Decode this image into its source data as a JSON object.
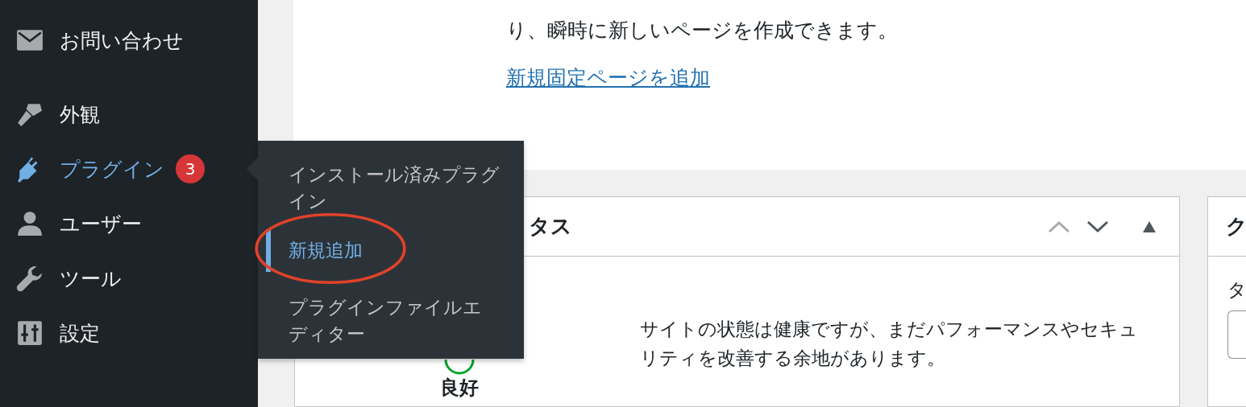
{
  "sidebar": {
    "items": [
      {
        "label": "お問い合わせ",
        "kind": "mail",
        "selected": false
      },
      {
        "label": "外観",
        "kind": "brush",
        "selected": false
      },
      {
        "label": "プラグイン",
        "kind": "plug",
        "selected": true,
        "badge": "3"
      },
      {
        "label": "ユーザー",
        "kind": "user",
        "selected": false
      },
      {
        "label": "ツール",
        "kind": "wrench",
        "selected": false
      },
      {
        "label": "設定",
        "kind": "sliders",
        "selected": false
      }
    ]
  },
  "flyout": {
    "items": [
      {
        "label": "インストール済みプラグイン",
        "selected": false
      },
      {
        "label": "新規追加",
        "selected": true
      },
      {
        "label": "プラグインファイルエディター",
        "selected": false
      }
    ]
  },
  "welcome": {
    "text": "り、瞬時に新しいページを作成できます。",
    "link": "新規固定ページを追加"
  },
  "site_health": {
    "title": "タス",
    "status": "良好",
    "message": "サイトの状態は健康ですが、まだパフォーマンスやセキュリティを改善する余地があります。"
  },
  "side_panel": {
    "title": "ク",
    "label": "タ"
  }
}
